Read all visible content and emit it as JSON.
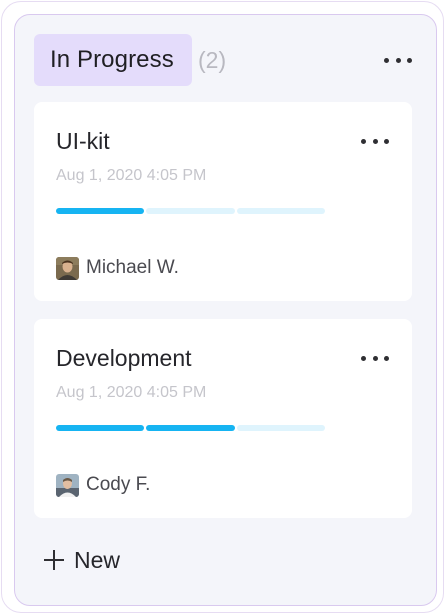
{
  "column": {
    "status": "In Progress",
    "count": "(2)",
    "more_icon": "more-horizontal-icon"
  },
  "cards": [
    {
      "title": "UI-kit",
      "date": "Aug 1, 2020 4:05 PM",
      "progress_segments": [
        true,
        false,
        false
      ],
      "assignee": "Michael W."
    },
    {
      "title": "Development",
      "date": "Aug 1, 2020 4:05 PM",
      "progress_segments": [
        true,
        true,
        false
      ],
      "assignee": "Cody F."
    }
  ],
  "new_button": {
    "label": "New",
    "icon": "plus-icon"
  },
  "colors": {
    "pill_bg": "#e4dcfb",
    "progress_on": "#16b4f2",
    "progress_off": "#dff4fd",
    "column_bg": "#f4f5fa",
    "column_border": "#d9c9ef"
  }
}
